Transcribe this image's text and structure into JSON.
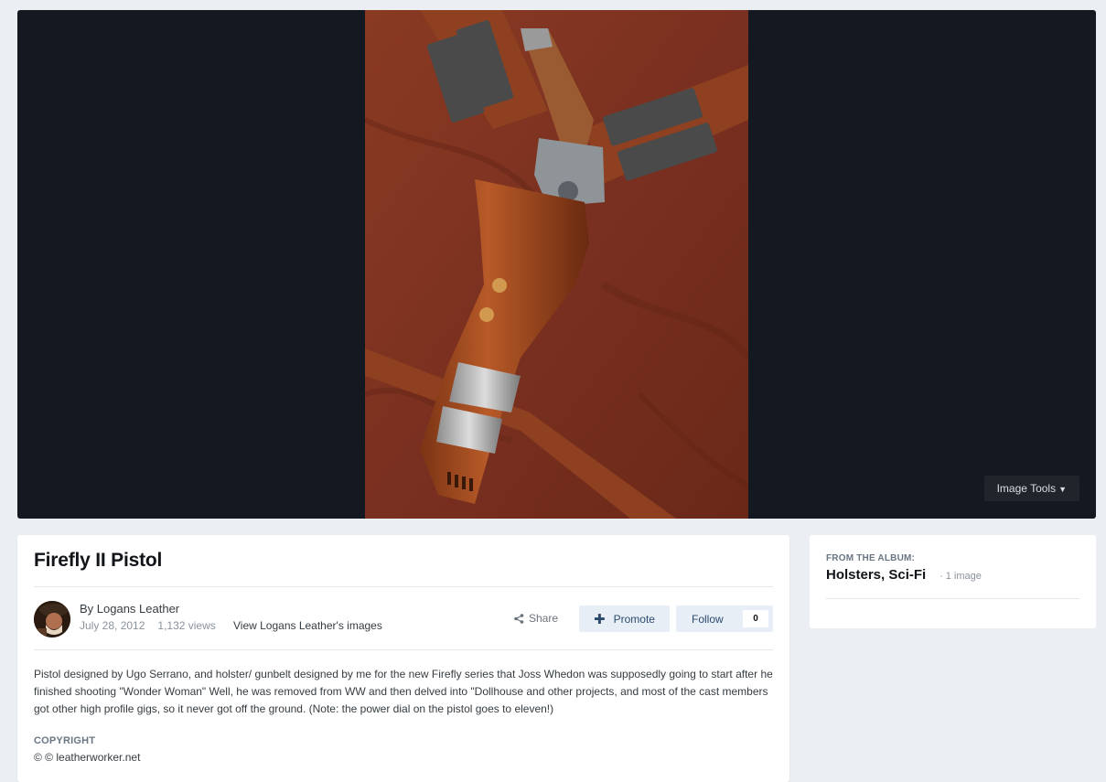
{
  "image_viewer": {
    "image_tools_label": "Image Tools",
    "caret_icon": "caret-down-icon"
  },
  "photo": {
    "subject": "leather holster with pistol on suede jacket"
  },
  "entry": {
    "title": "Firefly II Pistol",
    "author_line": "By Logans Leather",
    "date": "July 28, 2012",
    "views": "1,132 views",
    "view_images_link": "View Logans Leather's images",
    "share_label": "Share",
    "promote_label": "Promote",
    "follow_label": "Follow",
    "follow_count": "0",
    "description": "Pistol designed by Ugo Serrano, and holster/ gunbelt designed by me for the new Firefly series that Joss Whedon was supposedly going to start after he finished shooting \"Wonder Woman\" Well, he was removed from WW and then delved into \"Dollhouse and other projects, and most of the cast members got other high profile gigs, so it never got off the ground. (Note: the power dial on the pistol goes to eleven!)",
    "copyright_heading": "COPYRIGHT",
    "copyright_text": "© © leatherworker.net"
  },
  "album": {
    "heading": "FROM THE ALBUM:",
    "name": "Holsters, Sci-Fi",
    "count": "· 1 image"
  },
  "colors": {
    "page_bg": "#ebeef2",
    "lightbox_bg": "#141820",
    "button_bg": "#e8eef5",
    "button_text": "#2c4a6e"
  }
}
